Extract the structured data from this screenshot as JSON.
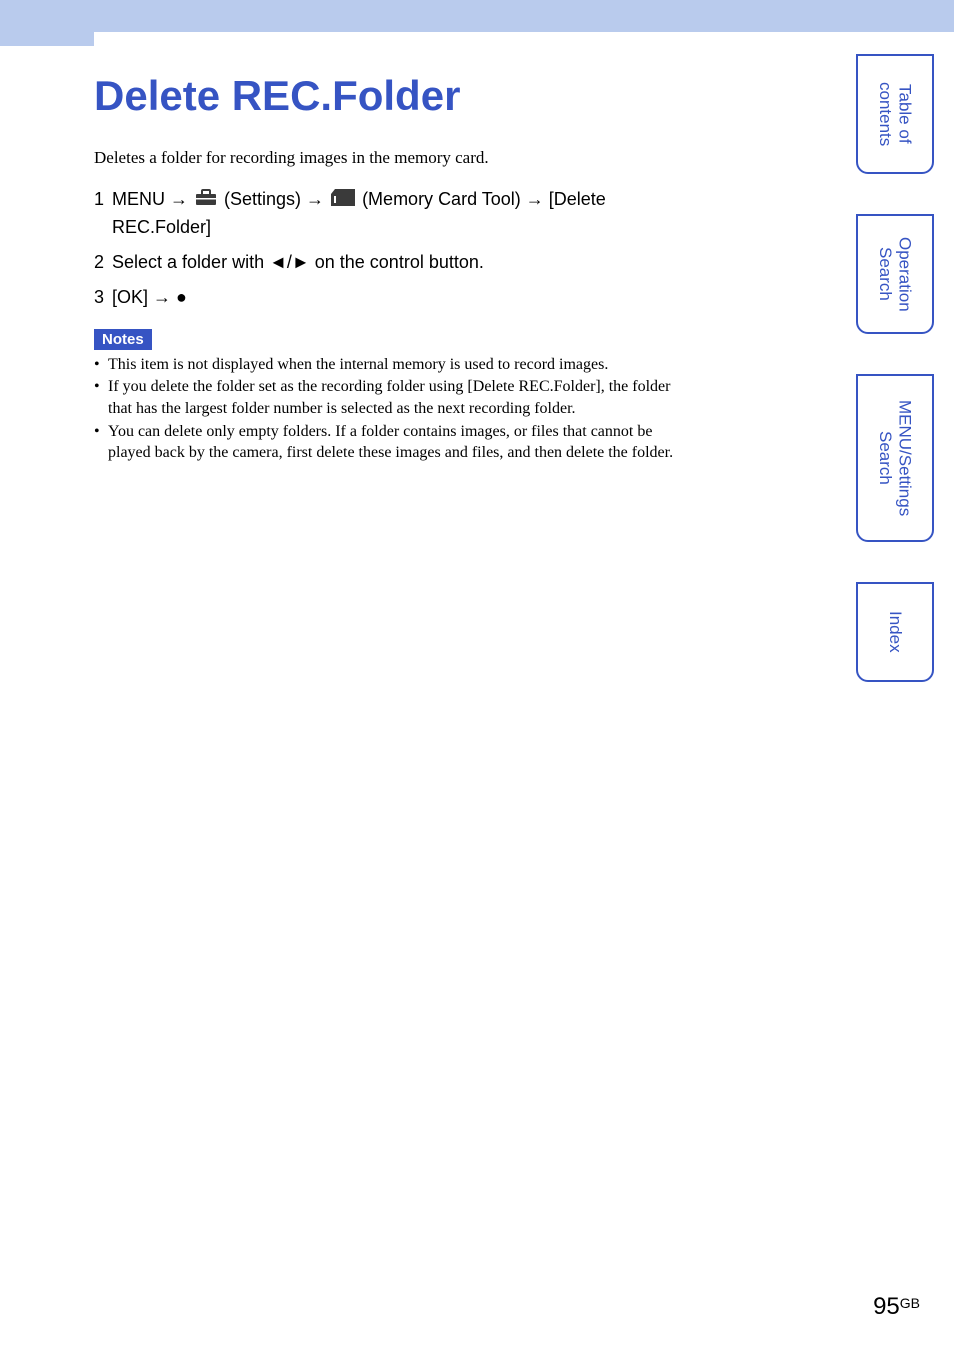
{
  "header": {
    "title": "Delete REC.Folder"
  },
  "intro": "Deletes a folder for recording images in the memory card.",
  "steps": [
    {
      "num": "1",
      "prefix": "MENU ",
      "arrow1": "→",
      "settings_label": " (Settings) ",
      "arrow2": "→",
      "memcard_label": " (Memory Card Tool) ",
      "arrow3": "→",
      "suffix": " [Delete REC.Folder]"
    },
    {
      "num": "2",
      "text_before": "Select a folder with ",
      "left_tri": "◄",
      "slash": "/",
      "right_tri": "►",
      "text_after": " on the control button."
    },
    {
      "num": "3",
      "text_before": "[OK] ",
      "arrow": "→",
      "dot": " ●"
    }
  ],
  "notes": {
    "label": "Notes",
    "items": [
      "This item is not displayed when the internal memory is used to record images.",
      "If you delete the folder set as the recording folder using [Delete REC.Folder], the folder that has the largest folder number is selected as the next recording folder.",
      "You can delete only empty folders. If a folder contains images, or files that cannot be played back by the camera, first delete these images and files, and then delete the folder."
    ]
  },
  "side_tabs": [
    {
      "label": "Table of\ncontents"
    },
    {
      "label": "Operation\nSearch"
    },
    {
      "label": "MENU/Settings\nSearch"
    },
    {
      "label": "Index"
    }
  ],
  "page": {
    "number": "95",
    "suffix": "GB"
  },
  "icons": {
    "settings": "settings-toolbox-icon",
    "memcard": "memory-card-icon"
  }
}
